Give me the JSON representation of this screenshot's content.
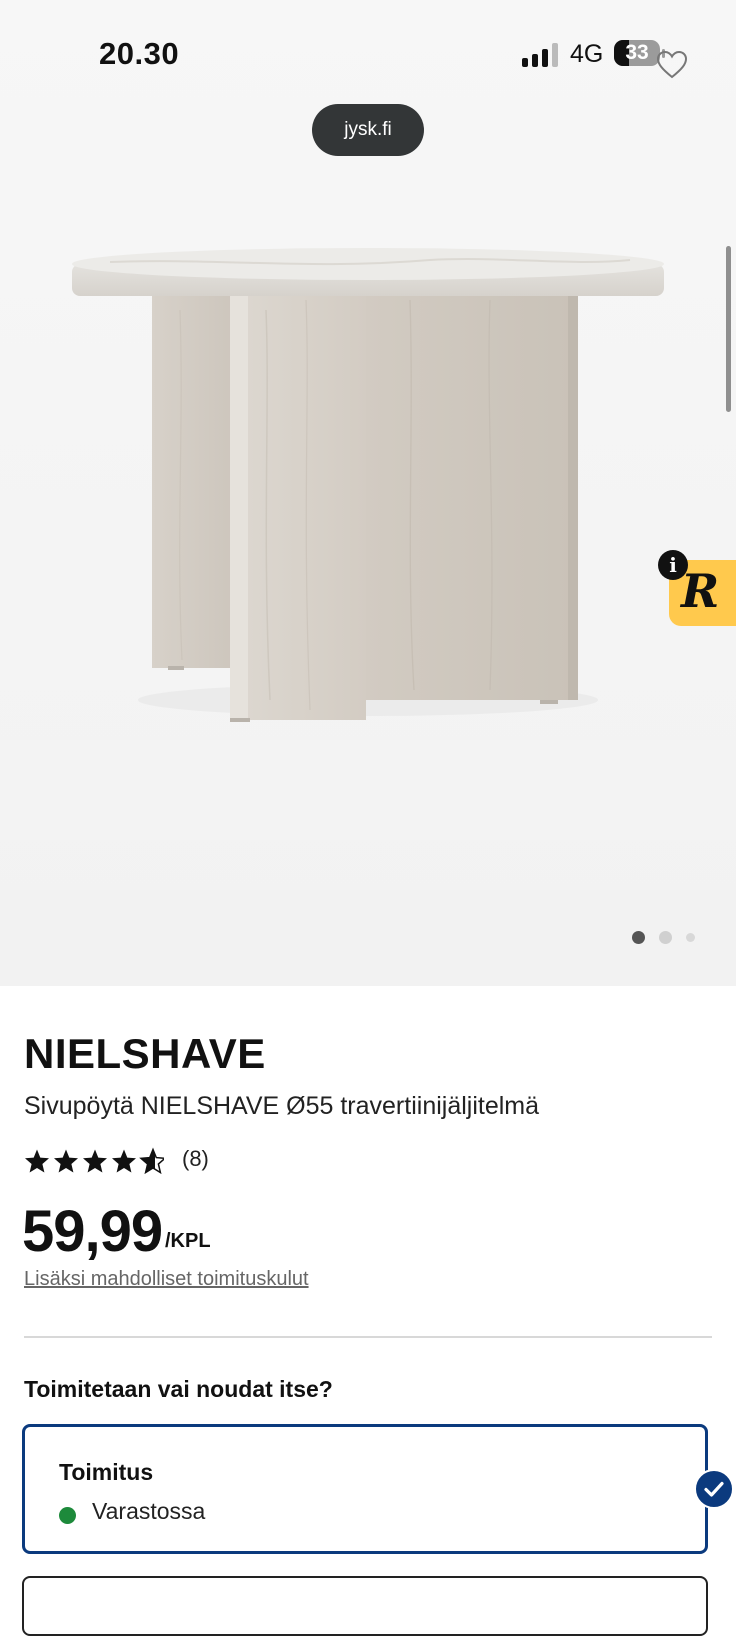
{
  "status_bar": {
    "time": "20.30",
    "network": "4G",
    "battery": "33",
    "battery_level": 0.33
  },
  "browser": {
    "url": "jysk.fi"
  },
  "gallery": {
    "image_alt": "Sivupöytä NIELSHAVE Ø55 travertiinijäljitelmä",
    "dot_count": 3,
    "active_dot": 0
  },
  "overlay_badge": {
    "info_glyph": "i",
    "logo_glyph": "R",
    "color": "#ffc94d"
  },
  "product": {
    "brand": "NIELSHAVE",
    "name": "Sivupöytä NIELSHAVE Ø55 travertiinijäljitelmä",
    "rating": 4.5,
    "review_count": "(8)",
    "price": "59,99",
    "unit": "/KPL",
    "shipping_note": "Lisäksi mahdolliset toimituskulut"
  },
  "delivery": {
    "question": "Toimitetaan vai noudat itse?",
    "option_title": "Toimitus",
    "stock_status": "Varastossa",
    "stock_color": "#1d8a3b",
    "selected_color": "#0b3a7e"
  }
}
